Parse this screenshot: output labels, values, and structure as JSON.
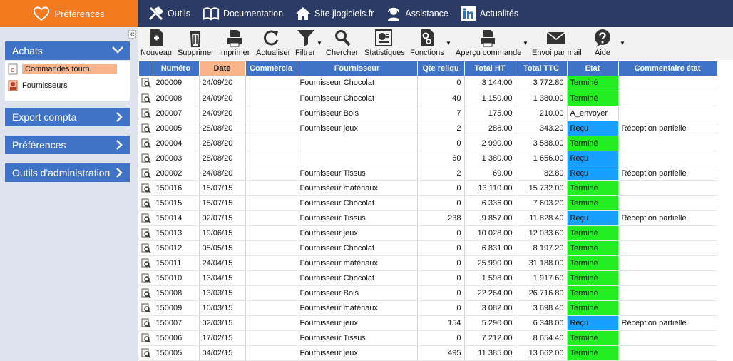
{
  "brand": {
    "label": "Préférences",
    "icon": "heart-icon"
  },
  "nav": [
    {
      "label": "Outils",
      "icon": "tools-icon"
    },
    {
      "label": "Documentation",
      "icon": "book-icon"
    },
    {
      "label": "Site jlogiciels.fr",
      "icon": "home-icon"
    },
    {
      "label": "Assistance",
      "icon": "headset-icon"
    },
    {
      "label": "Actualités",
      "icon": "linkedin-icon"
    }
  ],
  "sidebar": {
    "collapse_label": "«",
    "sections": [
      {
        "label": "Achats",
        "chevron": "∨"
      },
      {
        "label": "Export compta",
        "chevron": "›"
      },
      {
        "label": "Préférences",
        "chevron": "›"
      },
      {
        "label": "Outils d'administration",
        "chevron": "›"
      }
    ],
    "sub_items": [
      {
        "label": "Commandes fourn.",
        "active": true,
        "icon": "document-icon"
      },
      {
        "label": "Fournisseurs",
        "active": false,
        "icon": "supplier-icon"
      }
    ]
  },
  "toolbar": [
    {
      "label": "Nouveau",
      "icon": "new-document-icon"
    },
    {
      "label": "Supprimer",
      "icon": "trash-icon"
    },
    {
      "label": "Imprimer",
      "icon": "printer-icon"
    },
    {
      "label": "Actualiser",
      "icon": "refresh-icon"
    },
    {
      "label": "Filtrer",
      "icon": "filter-icon"
    },
    {
      "label": "Chercher",
      "icon": "search-icon"
    },
    {
      "label": "Statistiques",
      "icon": "statistics-icon"
    },
    {
      "label": "Fonctions",
      "icon": "gears-icon"
    },
    {
      "label": "Aperçu commande",
      "icon": "print-preview-icon"
    },
    {
      "label": "Envoi par mail",
      "icon": "mail-icon"
    },
    {
      "label": "Aide",
      "icon": "help-icon"
    }
  ],
  "grid": {
    "columns": [
      "Numéro",
      "Date",
      "Commercia",
      "Fournisseur",
      "Qte reliqu",
      "Total HT",
      "Total TTC",
      "Etat",
      "Commentaire état"
    ],
    "rows": [
      [
        "200009",
        "24/09/20",
        "",
        "Fournisseur Chocolat",
        "0",
        "3 144.00",
        "3 772.80",
        "Terminé",
        ""
      ],
      [
        "200008",
        "24/09/20",
        "",
        "Fournisseur Chocolat",
        "40",
        "1 150.00",
        "1 380.00",
        "Terminé",
        ""
      ],
      [
        "200007",
        "24/09/20",
        "",
        "Fournisseur Bois",
        "7",
        "175.00",
        "210.00",
        "A_envoyer",
        ""
      ],
      [
        "200005",
        "28/08/20",
        "",
        "Fournisseur jeux",
        "2",
        "286.00",
        "343.20",
        "Reçu",
        "Réception partielle"
      ],
      [
        "200004",
        "28/08/20",
        "",
        "",
        "0",
        "2 990.00",
        "3 588.00",
        "Terminé",
        ""
      ],
      [
        "200003",
        "28/08/20",
        "",
        "",
        "60",
        "1 380.00",
        "1 656.00",
        "Reçu",
        ""
      ],
      [
        "200002",
        "24/08/20",
        "",
        "Fournisseur Tissus",
        "2",
        "69.00",
        "82.80",
        "Reçu",
        "Réception partielle"
      ],
      [
        "150016",
        "15/07/15",
        "",
        "Fournisseur matériaux",
        "0",
        "13 110.00",
        "15 732.00",
        "Terminé",
        ""
      ],
      [
        "150015",
        "15/07/15",
        "",
        "Fournisseur Chocolat",
        "0",
        "6 336.00",
        "7 603.20",
        "Terminé",
        ""
      ],
      [
        "150014",
        "02/07/15",
        "",
        "Fournisseur Tissus",
        "238",
        "9 857.00",
        "11 828.40",
        "Reçu",
        "Réception partielle"
      ],
      [
        "150013",
        "19/06/15",
        "",
        "Fournisseur jeux",
        "0",
        "10 028.00",
        "12 033.60",
        "Terminé",
        ""
      ],
      [
        "150012",
        "05/05/15",
        "",
        "Fournisseur Chocolat",
        "0",
        "6 831.00",
        "8 197.20",
        "Terminé",
        ""
      ],
      [
        "150011",
        "24/04/15",
        "",
        "Fournisseur matériaux",
        "0",
        "25 990.00",
        "31 188.00",
        "Terminé",
        ""
      ],
      [
        "150010",
        "13/04/15",
        "",
        "Fournisseur Chocolat",
        "0",
        "1 598.00",
        "1 917.60",
        "Terminé",
        ""
      ],
      [
        "150008",
        "13/03/15",
        "",
        "Fournisseur Bois",
        "0",
        "22 264.00",
        "26 716.80",
        "Terminé",
        ""
      ],
      [
        "150009",
        "10/03/15",
        "",
        "Fournisseur matériaux",
        "0",
        "3 082.00",
        "3 698.40",
        "Terminé",
        ""
      ],
      [
        "150007",
        "02/03/15",
        "",
        "Fournisseur jeux",
        "154",
        "5 290.00",
        "6 348.00",
        "Reçu",
        "Réception partielle"
      ],
      [
        "150006",
        "17/02/15",
        "",
        "Fournisseur Tissus",
        "0",
        "7 212.00",
        "8 654.40",
        "Terminé",
        ""
      ],
      [
        "150005",
        "04/02/15",
        "",
        "Fournisseur jeux",
        "495",
        "11 385.00",
        "13 662.00",
        "Terminé",
        ""
      ]
    ]
  },
  "colors": {
    "topbar": "#2b3b66",
    "brand": "#f47a20",
    "accent": "#3e73c7",
    "sorted_header": "#f9b48a",
    "status_termine": "#22ee22",
    "status_recu": "#17a0ff"
  }
}
